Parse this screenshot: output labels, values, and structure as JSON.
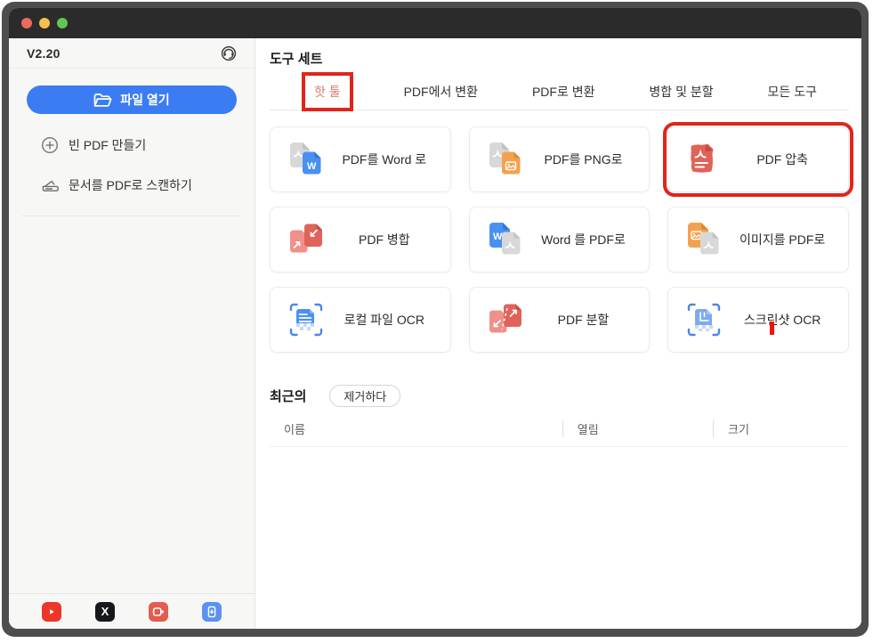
{
  "window": {
    "version": "V2.20",
    "traffic_lights": [
      "close",
      "minimize",
      "zoom"
    ]
  },
  "sidebar": {
    "open_file_label": "파일 열기",
    "items": [
      {
        "label": "빈 PDF 만들기",
        "icon": "plus-circle-icon"
      },
      {
        "label": "문서를 PDF로 스캔하기",
        "icon": "scanner-icon"
      }
    ],
    "support_icon": "headset-support-icon",
    "social_icons": [
      "youtube-icon",
      "x-icon",
      "video-record-icon",
      "mobile-app-download-icon"
    ]
  },
  "main": {
    "title": "도구 세트",
    "tabs": [
      {
        "label": "핫 툴",
        "active": true,
        "annotated": true
      },
      {
        "label": "PDF에서 변환",
        "active": false
      },
      {
        "label": "PDF로 변환",
        "active": false
      },
      {
        "label": "병합 및 분할",
        "active": false
      },
      {
        "label": "모든 도구",
        "active": false
      }
    ],
    "cards": [
      {
        "label": "PDF를 Word 로",
        "icon": "pdf-to-word-icon"
      },
      {
        "label": "PDF를 PNG로",
        "icon": "pdf-to-png-icon"
      },
      {
        "label": "PDF 압축",
        "icon": "pdf-compress-icon",
        "annotated": true
      },
      {
        "label": "PDF 병합",
        "icon": "pdf-merge-icon"
      },
      {
        "label": "Word 를 PDF로",
        "icon": "word-to-pdf-icon"
      },
      {
        "label": "이미지를 PDF로",
        "icon": "image-to-pdf-icon"
      },
      {
        "label": "로컬 파일 OCR",
        "icon": "local-file-ocr-icon"
      },
      {
        "label": "PDF 분할",
        "icon": "pdf-split-icon"
      },
      {
        "label": "스크린샷 OCR",
        "icon": "screenshot-ocr-icon",
        "cursor_mark": true
      }
    ],
    "recent": {
      "title": "최근의",
      "clear_label": "제거하다",
      "columns": [
        "이름",
        "열림",
        "크기"
      ]
    }
  },
  "colors": {
    "accent_blue": "#3b7cf3",
    "annotation_red": "#e1251b",
    "active_tab_red": "#dd7a72",
    "titlebar": "#2b2b2b",
    "sidebar_bg": "#f7f7f5",
    "doc_gray": "#d8d8d8",
    "doc_blue": "#4a90f2",
    "doc_orange": "#f2a24e",
    "doc_red": "#e0635a",
    "doc_pink": "#f0908a",
    "ocr_blue": "#4a86ee"
  }
}
